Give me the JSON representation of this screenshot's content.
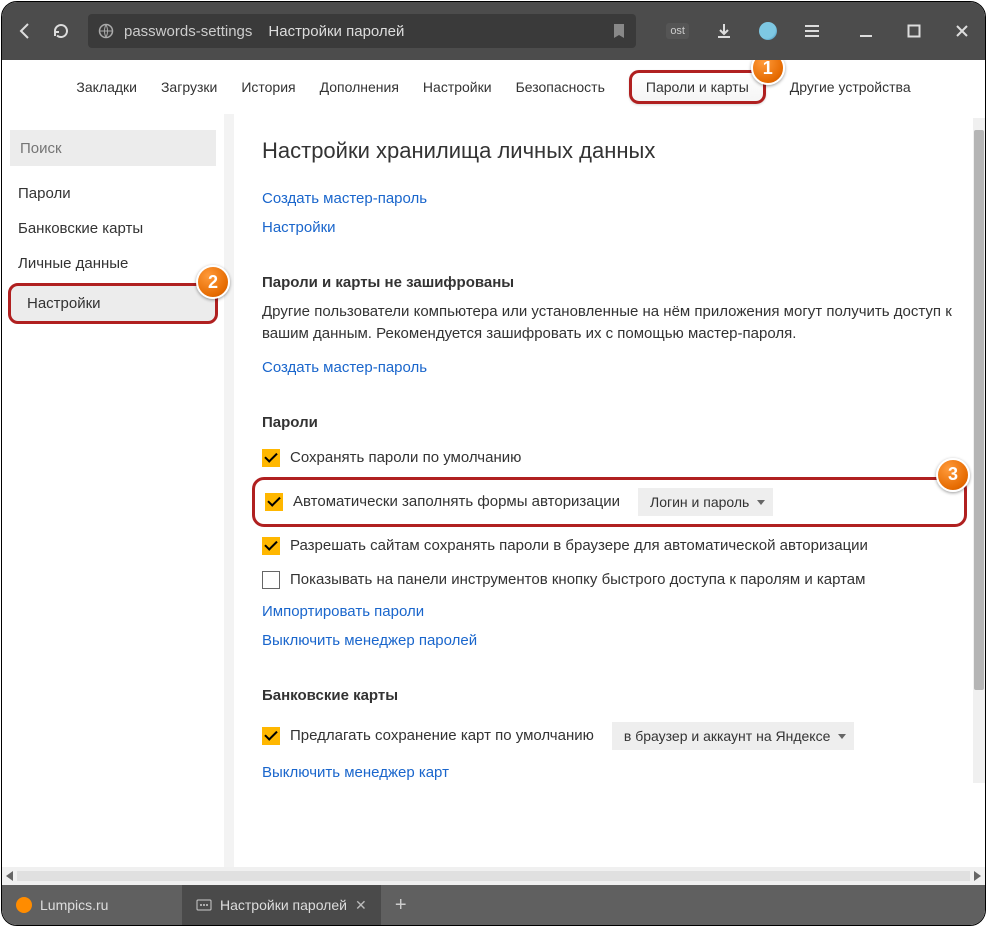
{
  "titlebar": {
    "url_segment": "passwords-settings",
    "page_title": "Настройки паролей",
    "extension_badge": "ost"
  },
  "topnav": {
    "items": [
      "Закладки",
      "Загрузки",
      "История",
      "Дополнения",
      "Настройки",
      "Безопасность",
      "Пароли и карты",
      "Другие устройства"
    ],
    "active_index": 6
  },
  "sidebar": {
    "search_placeholder": "Поиск",
    "items": [
      "Пароли",
      "Банковские карты",
      "Личные данные",
      "Настройки"
    ],
    "selected_index": 3
  },
  "panel": {
    "heading": "Настройки хранилища личных данных",
    "link_create_master": "Создать мастер-пароль",
    "link_settings": "Настройки",
    "encrypt": {
      "title": "Пароли и карты не зашифрованы",
      "desc": "Другие пользователи компьютера или установленные на нём приложения могут получить доступ к вашим данным. Рекомендуется зашифровать их с помощью мастер-пароля.",
      "link": "Создать мастер-пароль"
    },
    "passwords": {
      "title": "Пароли",
      "opt_save_default": "Сохранять пароли по умолчанию",
      "opt_autofill": "Автоматически заполнять формы авторизации",
      "autofill_dropdown": "Логин и пароль",
      "opt_allow_sites": "Разрешать сайтам сохранять пароли в браузере для автоматической авторизации",
      "opt_show_toolbar": "Показывать на панели инструментов кнопку быстрого доступа к паролям и картам",
      "link_import": "Импортировать пароли",
      "link_disable_mgr": "Выключить менеджер паролей"
    },
    "cards": {
      "title": "Банковские карты",
      "opt_offer_save": "Предлагать сохранение карт по умолчанию",
      "save_dropdown": "в браузер и аккаунт на Яндексе",
      "link_disable_mgr": "Выключить менеджер карт"
    }
  },
  "callouts": {
    "c1": "1",
    "c2": "2",
    "c3": "3"
  },
  "tabs": {
    "t1": "Lumpics.ru",
    "t2": "Настройки паролей"
  }
}
